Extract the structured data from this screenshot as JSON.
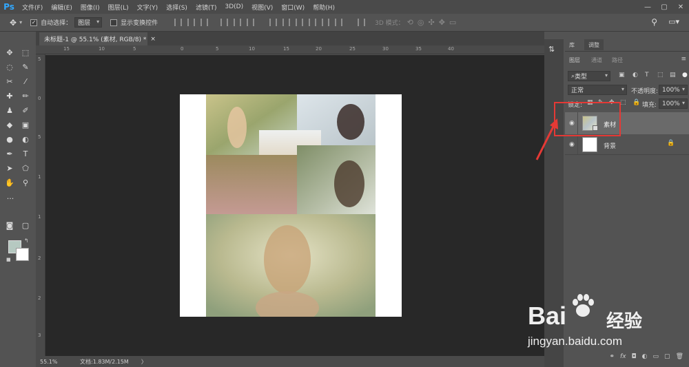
{
  "app": {
    "logo": "Ps"
  },
  "menubar": {
    "items": [
      "文件(F)",
      "编辑(E)",
      "图像(I)",
      "图层(L)",
      "文字(Y)",
      "选择(S)",
      "滤镜(T)",
      "3D(D)",
      "视图(V)",
      "窗口(W)",
      "帮助(H)"
    ]
  },
  "window_controls": [
    "—",
    "▢",
    "✕"
  ],
  "options_bar": {
    "auto_select_label": "自动选择：",
    "auto_select_value": "图层",
    "show_transform_label": "显示变换控件",
    "mode_3d_label": "3D 模式："
  },
  "document_tab": {
    "title": "未标题-1 @ 55.1% (素材, RGB/8) *",
    "close": "×"
  },
  "rulers": {
    "top": [
      "15",
      "10",
      "5",
      "0",
      "5",
      "10",
      "15",
      "20",
      "25",
      "30",
      "35",
      "40"
    ],
    "left": [
      "5",
      "0",
      "5",
      "1",
      "1",
      "2",
      "2",
      "3"
    ]
  },
  "status_bar": {
    "zoom": "55.1%",
    "doc_info": "文档:1.83M/2.15M",
    "arrow": "〉"
  },
  "panels": {
    "top_tabs": [
      "库",
      "调整"
    ],
    "layer_tabs": [
      "图层",
      "通道",
      "路径"
    ],
    "filter_kind": "类型",
    "blend_mode": "正常",
    "opacity_label": "不透明度:",
    "opacity_value": "100%",
    "lock_label": "锁定:",
    "fill_label": "填充:",
    "fill_value": "100%",
    "layers": [
      {
        "name": "素材",
        "visible": true,
        "selected": true
      },
      {
        "name": "背景",
        "visible": true,
        "locked": true
      }
    ],
    "bottom_icons": [
      "link-icon",
      "fx-icon",
      "mask-icon",
      "adjustment-icon",
      "group-icon",
      "new-layer-icon",
      "delete-icon"
    ]
  },
  "watermark": {
    "brand_text": "Bai",
    "brand_suffix": "经验",
    "url": "jingyan.baidu.com"
  },
  "colors": {
    "accent": "#31a8ff",
    "highlight": "#e53935",
    "foreground": "#b6c9c1",
    "background": "#ffffff"
  }
}
